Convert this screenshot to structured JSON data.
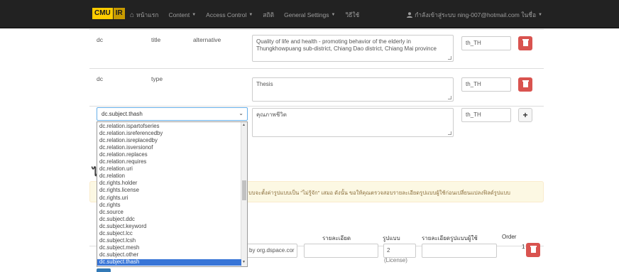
{
  "navbar": {
    "brand_cmu": "CMU",
    "brand_ir": "IR",
    "items": [
      {
        "label": "หน้าแรก",
        "has_caret": false
      },
      {
        "label": "Content",
        "has_caret": true
      },
      {
        "label": "Access Control",
        "has_caret": true
      },
      {
        "label": "สถิติ",
        "has_caret": false
      },
      {
        "label": "General Settings",
        "has_caret": true
      },
      {
        "label": "วิธีใช้",
        "has_caret": false
      }
    ],
    "user": "กำลังเข้าสู่ระบบ ning-007@hotmail.com ในชื่อ",
    "icons": {
      "home": "home-icon",
      "user": "user-icon",
      "caret": "caret-down-icon"
    }
  },
  "rows": [
    {
      "schema": "dc",
      "element": "title",
      "qualifier": "alternative",
      "value": "Quality of life and health - promoting behavior of the elderly in Thungkhowpuang sub-district, Chiang Dao district, Chiang Mai province",
      "lang": "th_TH"
    },
    {
      "schema": "dc",
      "element": "type",
      "qualifier": "",
      "value": "Thesis",
      "lang": "th_TH"
    }
  ],
  "new_field": {
    "selected": "dc.subject.thash",
    "value": "คุณภาพชีวิต",
    "lang": "th_TH"
  },
  "dropdown_options": [
    "dc.relation.ispartofseries",
    "dc.relation.isreferencedby",
    "dc.relation.isreplacedby",
    "dc.relation.isversionof",
    "dc.relation.replaces",
    "dc.relation.requires",
    "dc.relation.uri",
    "dc.relation",
    "dc.rights.holder",
    "dc.rights.license",
    "dc.rights.uri",
    "dc.rights",
    "dc.source",
    "dc.subject.ddc",
    "dc.subject.keyword",
    "dc.subject.lcc",
    "dc.subject.lcsh",
    "dc.subject.mesh",
    "dc.subject.other",
    "dc.subject.thash"
  ],
  "heading_fragment": "ไ",
  "alert_text": "บบจะตั้งค่ารูปแบบเป็น \"ไม่รู้จัก\" เสมอ ดังนั้น ขอให้คุณตรวจสอบรายละเอียดรูปแบบผู้ใช้ก่อนเปลี่ยนแปลงฟิลด์รูปแบบ",
  "table": {
    "headers": [
      "รายละเอียด",
      "รูปแบบ",
      "รายละเอียดรูปแบบผู้ใช้",
      "Order"
    ],
    "bitstream": {
      "description_fragment": "by org.dspace.cor",
      "format": "2",
      "format_name": "(License)",
      "order": "1"
    }
  },
  "colors": {
    "navbar_bg": "#222222",
    "brand_yellow": "#ffcc00",
    "delete_red": "#d9534f",
    "selected_blue": "#3875d7",
    "alert_bg": "#fcf8e3",
    "alert_text": "#8a6d3b"
  }
}
